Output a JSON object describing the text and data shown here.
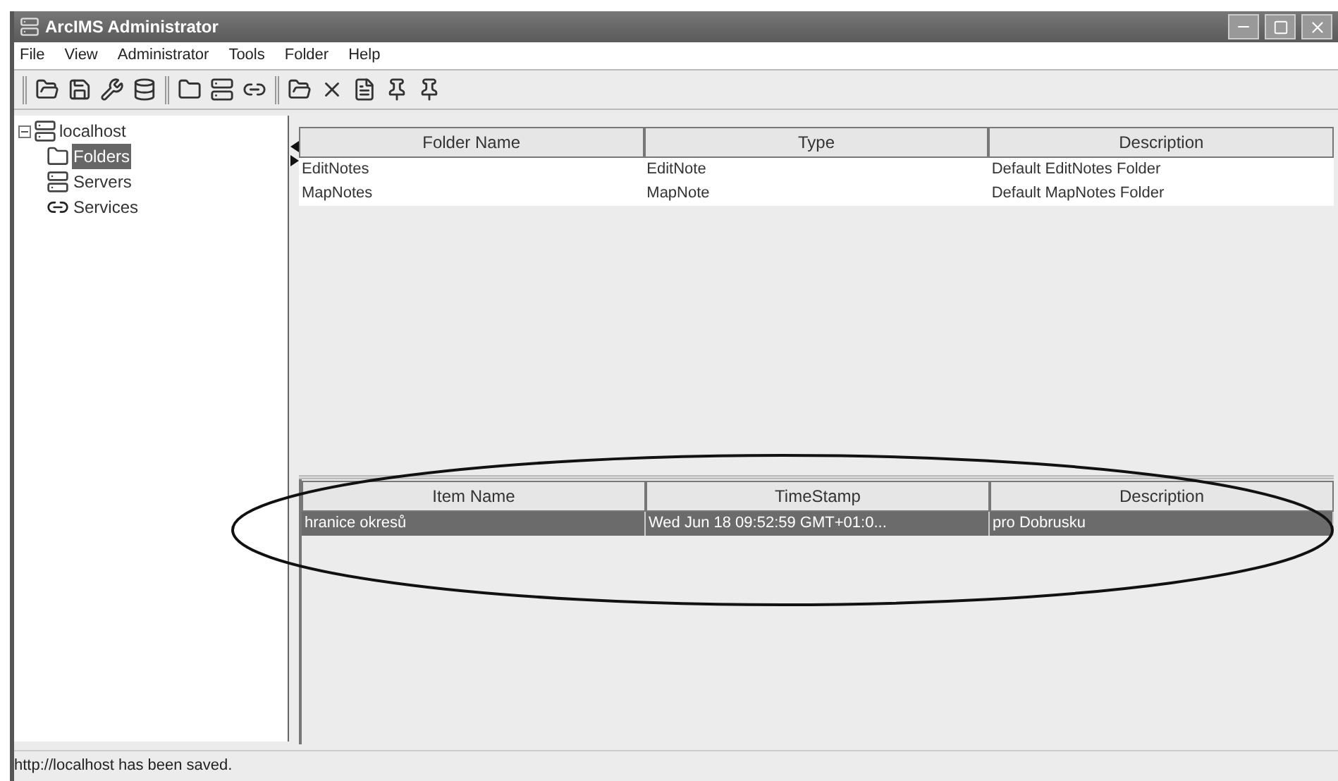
{
  "window": {
    "title": "ArcIMS Administrator"
  },
  "menu": [
    "File",
    "View",
    "Administrator",
    "Tools",
    "Folder",
    "Help"
  ],
  "tree": {
    "label": "localhost",
    "expanded": true,
    "children": [
      {
        "label": "Folders",
        "selected": true,
        "kind": "folder"
      },
      {
        "label": "Servers",
        "selected": false,
        "kind": "server"
      },
      {
        "label": "Services",
        "selected": false,
        "kind": "service"
      }
    ]
  },
  "folders_table": {
    "columns": [
      "Folder Name",
      "Type",
      "Description"
    ],
    "rows": [
      {
        "cells": [
          "EditNotes",
          "EditNote",
          "Default EditNotes Folder"
        ],
        "selected": false
      },
      {
        "cells": [
          "MapNotes",
          "MapNote",
          "Default MapNotes Folder"
        ],
        "selected": false
      }
    ]
  },
  "items_table": {
    "columns": [
      "Item Name",
      "TimeStamp",
      "Description"
    ],
    "rows": [
      {
        "cells": [
          "hranice okresů",
          "Wed Jun 18 09:52:59 GMT+01:0...",
          "pro Dobrusku"
        ],
        "selected": true
      }
    ]
  },
  "status_bar": "http://localhost has been saved."
}
